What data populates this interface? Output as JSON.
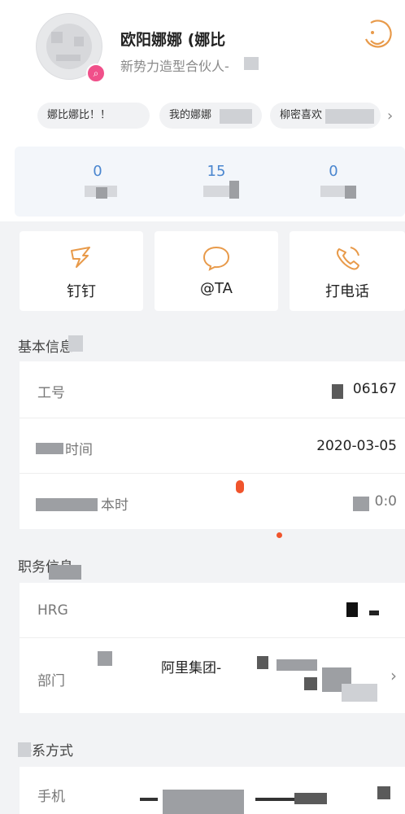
{
  "profile": {
    "name": "欧阳娜娜 (娜比",
    "subtitle": "新势力造型合伙人-",
    "badge_icon": "search-icon"
  },
  "tags": [
    {
      "label": "娜比娜比！！"
    },
    {
      "label": "我的娜娜"
    },
    {
      "label": "柳密喜欢"
    }
  ],
  "stats": [
    {
      "value": "0"
    },
    {
      "value": "15"
    },
    {
      "value": "0"
    }
  ],
  "actions": [
    {
      "label": "钉钉",
      "icon": "dingtalk-wing-icon"
    },
    {
      "label": "@TA",
      "icon": "chat-bubble-icon"
    },
    {
      "label": "打电话",
      "icon": "phone-icon"
    }
  ],
  "basic_info": {
    "title": "基本信息",
    "rows": [
      {
        "key": "工号",
        "value": "06167"
      },
      {
        "key": "时间",
        "value": "2020-03-05"
      },
      {
        "key": "本时",
        "value": "0:0"
      }
    ]
  },
  "job_info": {
    "title": "职务信息",
    "rows": [
      {
        "key": "HRG",
        "value": ""
      },
      {
        "key": "部门",
        "value": "阿里集团-"
      }
    ]
  },
  "contact": {
    "title": "联系方式",
    "rows": [
      {
        "key": "手机",
        "value": ""
      }
    ]
  },
  "colors": {
    "accent_orange": "#e89a4a",
    "stat_blue": "#4a86cf",
    "badge_pink": "#f0508a"
  }
}
